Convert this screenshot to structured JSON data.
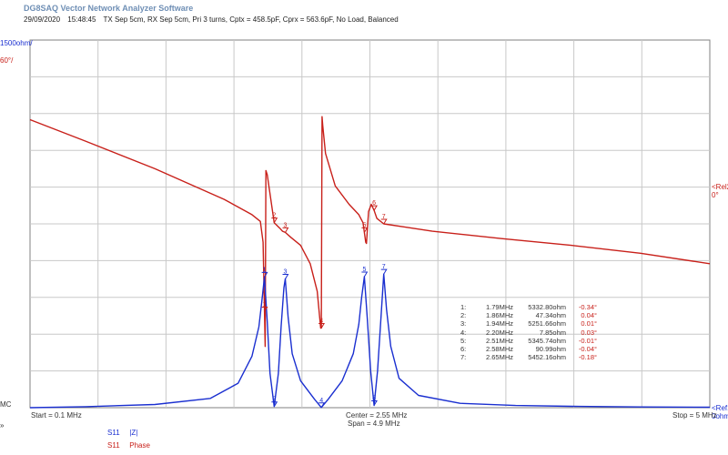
{
  "app": {
    "title": "DG8SAQ Vector Network Analyzer Software"
  },
  "header": {
    "date": "29/09/2020",
    "time": "15:48:45",
    "description": "TX Sep 5cm, RX Sep 5cm, Pri 3 turns, Cptx = 458.5pF, Cprx = 563.6pF, No Load, Balanced"
  },
  "axes": {
    "left_top_mag": "1500ohm/",
    "left_top_phase": "60°/",
    "right_phase_ref": "<Rel2",
    "right_phase_val": "0°",
    "right_mag_ref": "<Ref1",
    "right_mag_val": "0ohm",
    "left_bottom": "MC",
    "left_arrow": "»",
    "start": "Start = 0.1 MHz",
    "center": "Center = 2.55 MHz",
    "span": "Span = 4.9 MHz",
    "stop": "Stop = 5 MHz"
  },
  "legend": [
    {
      "param": "S11",
      "trace": "|Z|",
      "color": "#1a2fd0"
    },
    {
      "param": "S11",
      "trace": "Phase",
      "color": "#c8201a"
    }
  ],
  "markers": [
    {
      "id": "1:",
      "freq": "1.79MHz",
      "mag": "5332.80ohm",
      "phase": "-0.34°"
    },
    {
      "id": "2:",
      "freq": "1.86MHz",
      "mag": "47.34ohm",
      "phase": "0.04°"
    },
    {
      "id": "3:",
      "freq": "1.94MHz",
      "mag": "5251.66ohm",
      "phase": "0.01°"
    },
    {
      "id": "4:",
      "freq": "2.20MHz",
      "mag": "7.85ohm",
      "phase": "0.03°"
    },
    {
      "id": "5:",
      "freq": "2.51MHz",
      "mag": "5345.74ohm",
      "phase": "-0.01°"
    },
    {
      "id": "6:",
      "freq": "2.58MHz",
      "mag": "90.99ohm",
      "phase": "-0.04°"
    },
    {
      "id": "7:",
      "freq": "2.65MHz",
      "mag": "5452.16ohm",
      "phase": "-0.18°"
    }
  ],
  "colors": {
    "magnitude": "#1a2fd0",
    "phase": "#c8201a",
    "grid": "#c8c8c8",
    "frame": "#808080"
  },
  "chart_data": {
    "type": "line",
    "xlim": [
      0.1,
      5.0
    ],
    "x_unit": "MHz",
    "grid": true,
    "series": [
      {
        "name": "S11 |Z|",
        "axis": "magnitude",
        "unit": "ohm",
        "ylim": [
          0,
          15000
        ],
        "points": [
          [
            0.1,
            0
          ],
          [
            0.5,
            40
          ],
          [
            1.0,
            130
          ],
          [
            1.4,
            380
          ],
          [
            1.6,
            1000
          ],
          [
            1.7,
            2100
          ],
          [
            1.75,
            3300
          ],
          [
            1.77,
            4300
          ],
          [
            1.79,
            5333
          ],
          [
            1.81,
            3500
          ],
          [
            1.83,
            1400
          ],
          [
            1.86,
            47
          ],
          [
            1.89,
            1400
          ],
          [
            1.91,
            3300
          ],
          [
            1.93,
            4900
          ],
          [
            1.94,
            5252
          ],
          [
            1.96,
            3700
          ],
          [
            1.99,
            2200
          ],
          [
            2.05,
            1100
          ],
          [
            2.15,
            350
          ],
          [
            2.2,
            8
          ],
          [
            2.25,
            350
          ],
          [
            2.35,
            1100
          ],
          [
            2.43,
            2200
          ],
          [
            2.47,
            3400
          ],
          [
            2.49,
            4500
          ],
          [
            2.51,
            5346
          ],
          [
            2.53,
            3700
          ],
          [
            2.555,
            1500
          ],
          [
            2.58,
            91
          ],
          [
            2.605,
            1500
          ],
          [
            2.63,
            3700
          ],
          [
            2.65,
            5452
          ],
          [
            2.67,
            4000
          ],
          [
            2.7,
            2500
          ],
          [
            2.76,
            1200
          ],
          [
            2.9,
            500
          ],
          [
            3.2,
            180
          ],
          [
            3.6,
            90
          ],
          [
            4.0,
            55
          ],
          [
            4.5,
            30
          ],
          [
            5.0,
            20
          ]
        ]
      },
      {
        "name": "S11 Phase",
        "axis": "phase",
        "unit": "deg",
        "ylim": [
          -300,
          300
        ],
        "points": [
          [
            0.1,
            170
          ],
          [
            0.5,
            135
          ],
          [
            1.0,
            90
          ],
          [
            1.5,
            40
          ],
          [
            1.7,
            15
          ],
          [
            1.76,
            4
          ],
          [
            1.78,
            -30
          ],
          [
            1.795,
            -200
          ],
          [
            1.8,
            87
          ],
          [
            1.81,
            80
          ],
          [
            1.86,
            2
          ],
          [
            1.9,
            -7
          ],
          [
            1.92,
            -12
          ],
          [
            1.94,
            -14
          ],
          [
            1.98,
            -22
          ],
          [
            2.05,
            -35
          ],
          [
            2.12,
            -65
          ],
          [
            2.17,
            -110
          ],
          [
            2.195,
            -170
          ],
          [
            2.2,
            -170
          ],
          [
            2.205,
            175
          ],
          [
            2.21,
            160
          ],
          [
            2.23,
            115
          ],
          [
            2.3,
            62
          ],
          [
            2.4,
            32
          ],
          [
            2.47,
            15
          ],
          [
            2.5,
            2
          ],
          [
            2.52,
            -30
          ],
          [
            2.525,
            -32
          ],
          [
            2.54,
            20
          ],
          [
            2.56,
            32
          ],
          [
            2.58,
            22
          ],
          [
            2.6,
            9
          ],
          [
            2.65,
            0
          ],
          [
            2.8,
            -5
          ],
          [
            3.0,
            -12
          ],
          [
            3.5,
            -24
          ],
          [
            4.0,
            -35
          ],
          [
            4.5,
            -48
          ],
          [
            5.0,
            -65
          ]
        ]
      }
    ],
    "marker_points": [
      {
        "label": "1",
        "x": 1.79,
        "mag": 5332.8
      },
      {
        "label": "2",
        "x": 1.86,
        "mag": 47.34
      },
      {
        "label": "3",
        "x": 1.94,
        "mag": 5251.66
      },
      {
        "label": "4",
        "x": 2.2,
        "mag": 7.85
      },
      {
        "label": "5",
        "x": 2.51,
        "mag": 5345.74
      },
      {
        "label": "6",
        "x": 2.58,
        "mag": 90.99
      },
      {
        "label": "7",
        "x": 2.65,
        "mag": 5452.16
      }
    ]
  }
}
